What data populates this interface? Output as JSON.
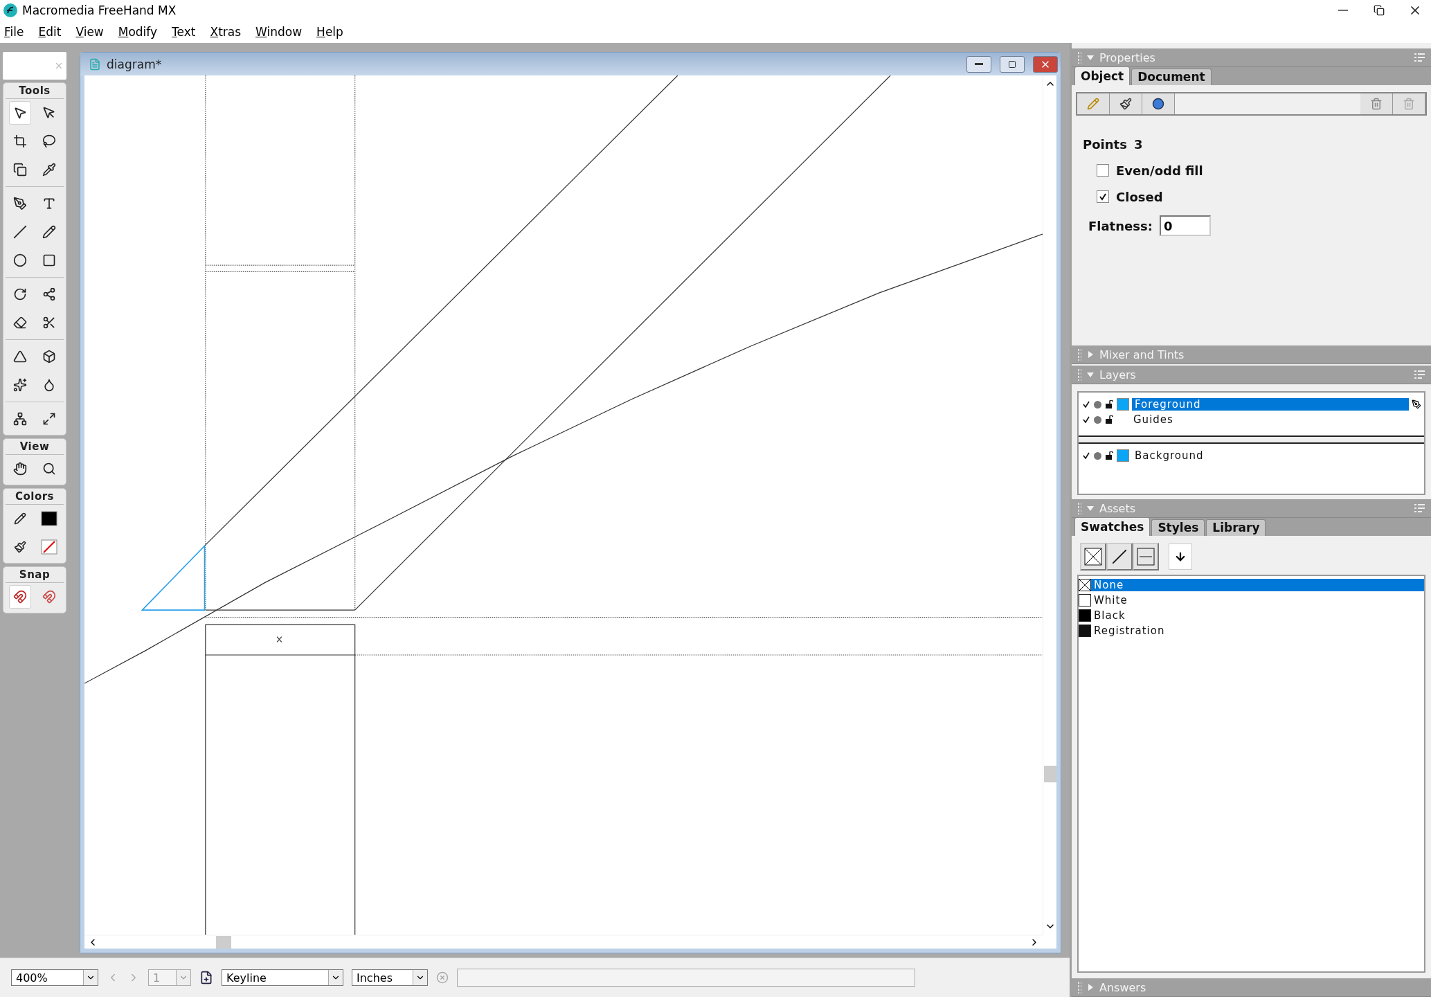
{
  "app": {
    "title": "Macromedia FreeHand MX"
  },
  "menu": [
    {
      "label": "File"
    },
    {
      "label": "Edit"
    },
    {
      "label": "View"
    },
    {
      "label": "Modify"
    },
    {
      "label": "Text"
    },
    {
      "label": "Xtras"
    },
    {
      "label": "Window"
    },
    {
      "label": "Help"
    }
  ],
  "toolbox": [
    {
      "title": "Tools",
      "tools": [
        {
          "selected": true
        },
        {
          "selected": false
        },
        {
          "selected": false
        },
        {
          "selected": false
        },
        {
          "selected": false
        },
        {
          "selected": false
        },
        {
          "selected": false
        },
        {
          "selected": false
        },
        {
          "selected": false
        },
        {
          "selected": false
        },
        {
          "selected": false
        },
        {
          "selected": false
        },
        {
          "selected": false
        },
        {
          "selected": false
        },
        {
          "selected": false
        },
        {
          "selected": false
        },
        {
          "selected": false
        },
        {
          "selected": false
        },
        {
          "selected": false
        },
        {
          "selected": false
        },
        {
          "selected": false
        },
        {
          "selected": false
        }
      ]
    },
    {
      "title": "View",
      "tools": [
        {
          "selected": false
        },
        {
          "selected": false
        }
      ]
    },
    {
      "title": "Colors",
      "tools": [
        {
          "selected": false
        },
        {
          "selected": false
        },
        {
          "selected": false
        },
        {
          "selected": false
        }
      ]
    },
    {
      "title": "Snap",
      "tools": [
        {
          "selected": true
        },
        {
          "selected": false
        }
      ]
    }
  ],
  "document": {
    "title": "diagram*"
  },
  "properties": {
    "title": "Properties",
    "expanded": true,
    "tabs": [
      {
        "label": "Object",
        "selected": true
      },
      {
        "label": "Document",
        "selected": false
      }
    ],
    "points_label": "Points",
    "points_value": "3",
    "options": [
      {
        "label": "Even/odd fill",
        "checked": false
      },
      {
        "label": "Closed",
        "checked": true
      }
    ],
    "flatness": {
      "label": "Flatness:",
      "value": "0"
    }
  },
  "mixer": {
    "title": "Mixer and Tints",
    "expanded": false
  },
  "layers": {
    "title": "Layers",
    "expanded": true,
    "printing": [
      {
        "name": "Foreground",
        "selected": true,
        "color": "#0aa6f5"
      },
      {
        "name": "Guides",
        "selected": false
      }
    ],
    "nonprinting": [
      {
        "name": "Background",
        "selected": false,
        "color": "#0aa6f5"
      }
    ]
  },
  "assets": {
    "title": "Assets",
    "expanded": true,
    "tabs": [
      {
        "label": "Swatches",
        "selected": true
      },
      {
        "label": "Styles",
        "selected": false
      },
      {
        "label": "Library",
        "selected": false
      }
    ],
    "swatches": [
      {
        "name": "None",
        "kind": "none",
        "selected": true
      },
      {
        "name": "White",
        "kind": "color",
        "color": "#ffffff",
        "selected": false
      },
      {
        "name": "Black",
        "kind": "color",
        "color": "#000000",
        "selected": false
      },
      {
        "name": "Registration",
        "kind": "color",
        "color": "#111111",
        "selected": false
      }
    ]
  },
  "answers": {
    "title": "Answers",
    "expanded": false
  },
  "status_bar": {
    "zoom": "400%",
    "page": "1",
    "view_mode": "Keyline",
    "units": "Inches"
  }
}
